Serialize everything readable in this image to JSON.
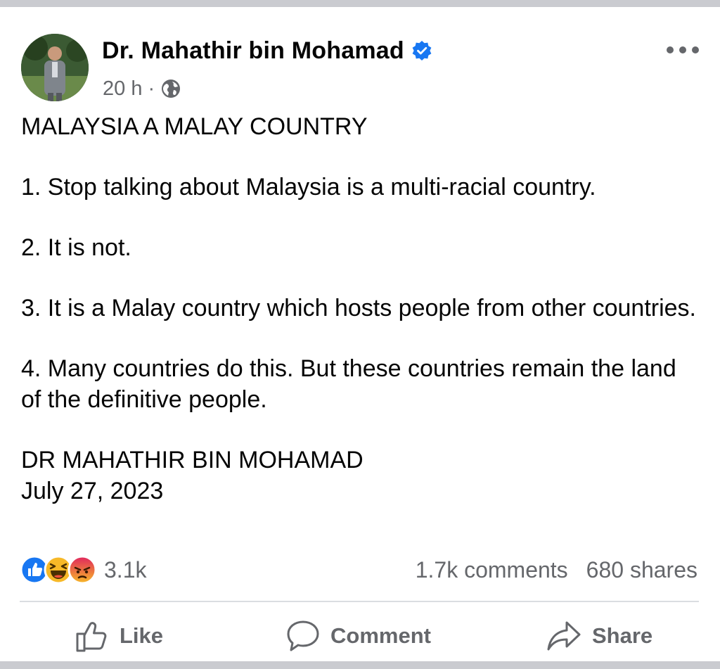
{
  "post": {
    "author_name": "Dr. Mahathir bin Mohamad",
    "time_ago": "20 h",
    "separator": "·",
    "privacy_icon": "globe-icon",
    "verified_icon": "verified-badge-icon",
    "more_icon": "more-options-icon",
    "body": {
      "heading": "MALAYSIA A MALAY COUNTRY",
      "point1": "1. Stop talking about Malaysia is a multi-racial country.",
      "point2": "2. It is not.",
      "point3": "3. It is a Malay country which hosts people from other countries.",
      "point4": "4. Many countries do this. But these countries remain the land of the definitive people.",
      "signature": "DR MAHATHIR BIN MOHAMAD",
      "date": "July 27, 2023"
    }
  },
  "engagement": {
    "reaction_icons": [
      "like-reaction-icon",
      "haha-reaction-icon",
      "angry-reaction-icon"
    ],
    "reactions_count": "3.1k",
    "comments": "1.7k comments",
    "shares": "680 shares"
  },
  "actions": {
    "like": "Like",
    "comment": "Comment",
    "share": "Share"
  },
  "colors": {
    "verified": "#1877f2",
    "secondary_text": "#65676b",
    "like_blue": "#1877f2",
    "haha_yellow": "#f7b928",
    "angry_orange": "#e9710f"
  }
}
